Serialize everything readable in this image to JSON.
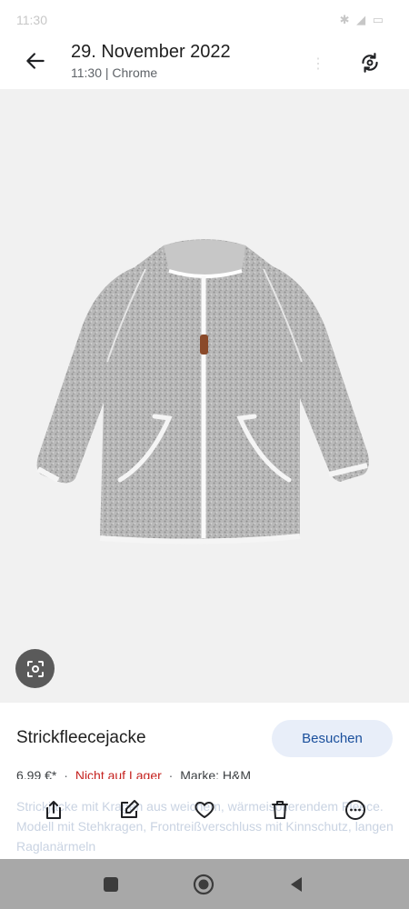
{
  "status_bar": {
    "time": "11:30",
    "icons": "✱ ◢ ▭"
  },
  "header": {
    "title": "29. November 2022",
    "subtitle": "11:30 | Chrome"
  },
  "product": {
    "title": "Strickfleecejacke",
    "visit_label": "Besuchen",
    "price": "6,99 €*",
    "stock": "Nicht auf Lager",
    "brand": "Marke: H&M",
    "description": "Strickjacke mit Kragen aus weichem, wärmeisolierendem Fleece. Modell mit Stehkragen, Frontreißverschluss mit Kinnschutz, langen Raglanärmeln"
  },
  "actions": {
    "share": "share-icon",
    "edit": "edit-icon",
    "favorite": "heart-icon",
    "delete": "trash-icon",
    "more": "more-icon"
  },
  "nav": {
    "recents": "square-icon",
    "home": "circle-icon",
    "back": "triangle-icon"
  },
  "colors": {
    "accent": "#1a4f9c",
    "visit_bg": "#e8eef9",
    "stock_red": "#c5221f",
    "nav_bg": "#a8a8a8"
  }
}
